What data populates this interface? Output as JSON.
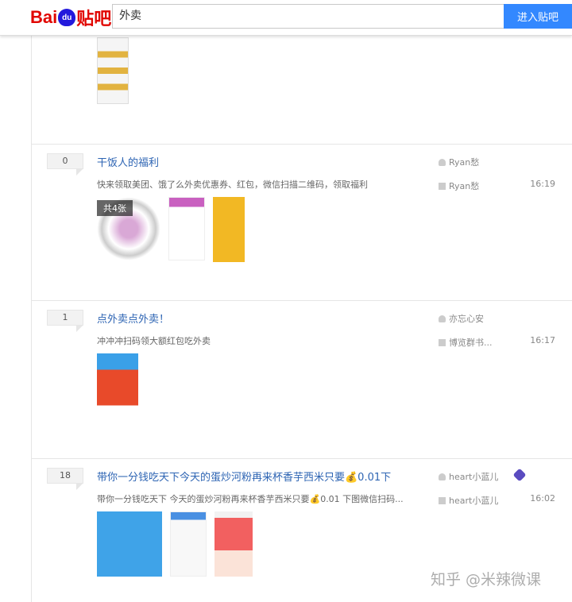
{
  "header": {
    "logo": "Bai du 贴吧",
    "search_value": "外卖",
    "enter_button": "进入贴吧"
  },
  "threads": [
    {
      "replies": "0",
      "title": "干饭人的福利",
      "abstract": "快来领取美团、饿了么外卖优惠券、红包，微信扫描二维码，领取福利",
      "author": "Ryan愁",
      "last_reply": "Ryan愁",
      "time": "16:19",
      "image_badge": "共4张"
    },
    {
      "replies": "1",
      "title": "点外卖点外卖！",
      "abstract": "冲冲冲扫码领大额红包吃外卖",
      "author": "亦忘心安",
      "last_reply": "博览群书...",
      "time": "16:17"
    },
    {
      "replies": "18",
      "title": "带你一分钱吃天下今天的蛋炒河粉再来杯香芋西米只要💰0.01下",
      "abstract": "带你一分钱吃天下 今天的蛋炒河粉再来杯香芋西米只要💰0.01 下图微信扫码...",
      "author": "heart小蓝儿",
      "last_reply": "heart小蓝儿",
      "time": "16:02"
    }
  ],
  "watermark": "知乎 @米辣微课"
}
